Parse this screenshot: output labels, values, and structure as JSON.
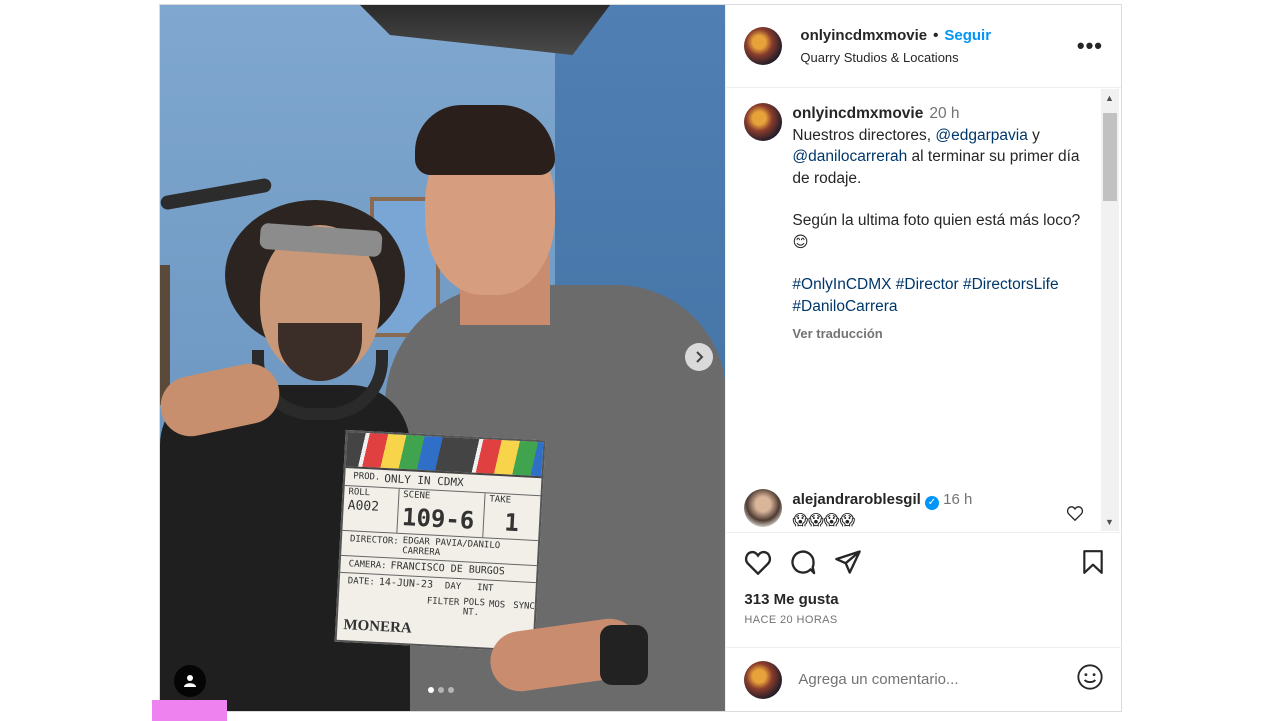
{
  "post": {
    "username": "onlyincdmxmovie",
    "separator": "•",
    "follow_label": "Seguir",
    "location": "Quarry Studios & Locations",
    "more_label": "•••"
  },
  "photo": {
    "clapper": {
      "prod_label": "PROD.",
      "prod_value": "ONLY IN CDMX",
      "roll_label": "ROLL",
      "roll_value": "A002",
      "scene_label": "SCENE",
      "scene_value": "109-6",
      "take_label": "TAKE",
      "take_value": "1",
      "director_label": "DIRECTOR:",
      "director_value": "EDGAR PAVIA/DANILO CARRERA",
      "camera_label": "CAMERA:",
      "camera_value": "FRANCISCO DE BURGOS",
      "date_label": "DATE:",
      "date_value": "14-JUN-23",
      "day_label": "DAY",
      "filter_label": "FILTER",
      "filter_value": "POLS NT.",
      "int_label": "INT",
      "mos_label": "MOS",
      "sync_label": "SYNC",
      "brand": "MONERA"
    },
    "carousel": {
      "total": 3,
      "active": 1
    }
  },
  "caption": {
    "username": "onlyincdmxmovie",
    "time": "20 h",
    "text_1": "Nuestros directores, ",
    "mention_1": "@edgarpavia",
    "text_2": " y ",
    "mention_2": "@danilocarrerah",
    "text_3": " al terminar su primer día de rodaje.",
    "text_4": "Según la ultima foto quien está más loco? 😊",
    "hashtag_1": "#OnlyInCDMX",
    "hashtag_2": "#Director",
    "hashtag_3": "#DirectorsLife",
    "hashtag_4": "#DaniloCarrera",
    "translate_label": "Ver traducción"
  },
  "comment": {
    "username": "alejandraroblesgil",
    "verified_mark": "✓",
    "time": "16 h",
    "text": "😱😱😱😱"
  },
  "actions": {
    "likes": "313 Me gusta",
    "ago": "HACE 20 HORAS"
  },
  "add_comment": {
    "placeholder": "Agrega un comentario..."
  }
}
